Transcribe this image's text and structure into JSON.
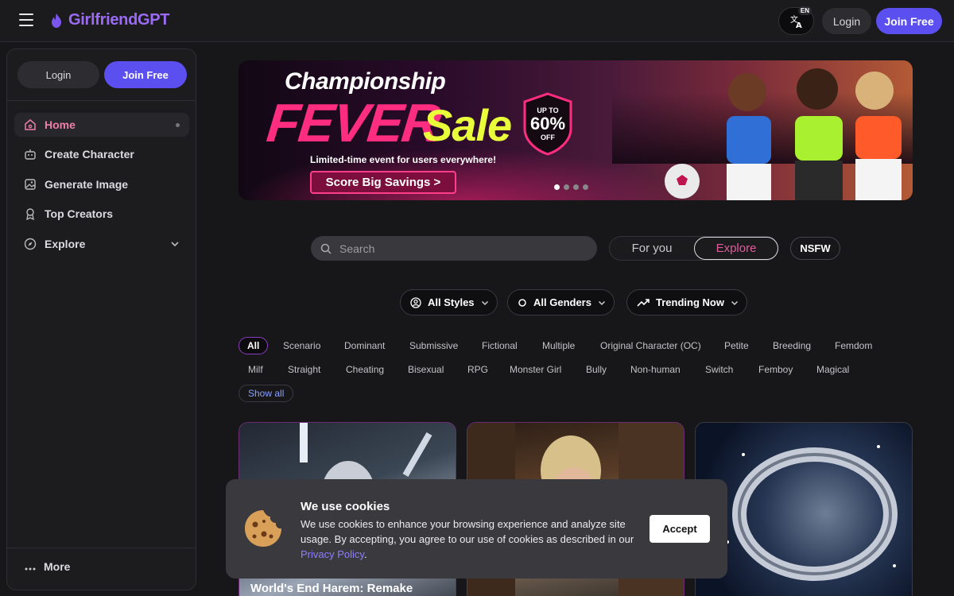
{
  "header": {
    "logo_text": "GirlfriendGPT",
    "lang_tag": "EN",
    "login_label": "Login",
    "join_label": "Join Free",
    "brand_color": "#9b6cf3"
  },
  "sidebar": {
    "login_label": "Login",
    "join_label": "Join Free",
    "items": [
      {
        "label": "Home",
        "icon": "home-icon"
      },
      {
        "label": "Create Character",
        "icon": "bot-icon"
      },
      {
        "label": "Generate Image",
        "icon": "image-icon"
      },
      {
        "label": "Top Creators",
        "icon": "award-icon"
      },
      {
        "label": "Explore",
        "icon": "compass-icon"
      }
    ],
    "more_label": "More"
  },
  "banner": {
    "line1": "Championship",
    "line2": "FEVER",
    "line3": "Sale",
    "subtitle": "Limited-time event for users everywhere!",
    "cta": "Score Big Savings >",
    "badge_top": "UP TO",
    "badge_value": "60%",
    "badge_bottom": "OFF",
    "slide_count": 4,
    "active_slide": 1
  },
  "search": {
    "placeholder": "Search"
  },
  "view_toggle": {
    "for_you": "For you",
    "explore": "Explore",
    "selected": "Explore"
  },
  "nsfw_label": "NSFW",
  "filters": {
    "styles": "All Styles",
    "genders": "All Genders",
    "sort": "Trending Now"
  },
  "tags": {
    "all": "All",
    "row1": [
      "Scenario",
      "Dominant",
      "Submissive",
      "Fictional",
      "Multiple",
      "Original Character (OC)",
      "Petite",
      "Breeding",
      "Femdom"
    ],
    "row2": [
      "Milf",
      "Straight",
      "Cheating",
      "Bisexual",
      "RPG",
      "Monster Girl",
      "Bully",
      "Non-human",
      "Switch",
      "Femboy",
      "Magical"
    ],
    "show_all": "Show all"
  },
  "cards": [
    {
      "title": "World's End Harem: Remake"
    },
    {
      "title": ""
    },
    {
      "title": ""
    }
  ],
  "cookie": {
    "title": "We use cookies",
    "body": "We use cookies to enhance your browsing experience and analyze site usage. By accepting, you agree to our use of cookies as described in our ",
    "link": "Privacy Policy",
    "suffix": ".",
    "accept": "Accept"
  }
}
